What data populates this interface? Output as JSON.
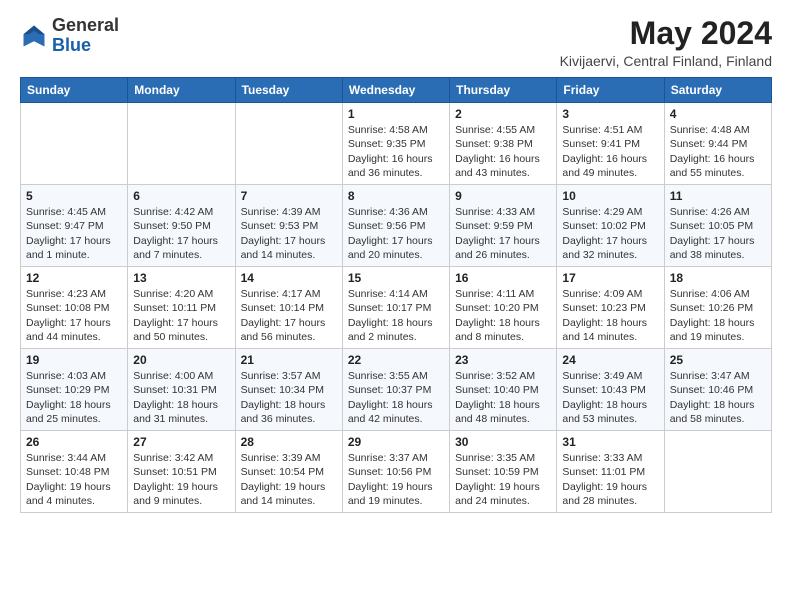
{
  "header": {
    "logo": {
      "general": "General",
      "blue": "Blue"
    },
    "title": "May 2024",
    "location": "Kivijaervi, Central Finland, Finland"
  },
  "days_of_week": [
    "Sunday",
    "Monday",
    "Tuesday",
    "Wednesday",
    "Thursday",
    "Friday",
    "Saturday"
  ],
  "weeks": [
    [
      {
        "day": "",
        "info": ""
      },
      {
        "day": "",
        "info": ""
      },
      {
        "day": "",
        "info": ""
      },
      {
        "day": "1",
        "info": "Sunrise: 4:58 AM\nSunset: 9:35 PM\nDaylight: 16 hours and 36 minutes."
      },
      {
        "day": "2",
        "info": "Sunrise: 4:55 AM\nSunset: 9:38 PM\nDaylight: 16 hours and 43 minutes."
      },
      {
        "day": "3",
        "info": "Sunrise: 4:51 AM\nSunset: 9:41 PM\nDaylight: 16 hours and 49 minutes."
      },
      {
        "day": "4",
        "info": "Sunrise: 4:48 AM\nSunset: 9:44 PM\nDaylight: 16 hours and 55 minutes."
      }
    ],
    [
      {
        "day": "5",
        "info": "Sunrise: 4:45 AM\nSunset: 9:47 PM\nDaylight: 17 hours and 1 minute."
      },
      {
        "day": "6",
        "info": "Sunrise: 4:42 AM\nSunset: 9:50 PM\nDaylight: 17 hours and 7 minutes."
      },
      {
        "day": "7",
        "info": "Sunrise: 4:39 AM\nSunset: 9:53 PM\nDaylight: 17 hours and 14 minutes."
      },
      {
        "day": "8",
        "info": "Sunrise: 4:36 AM\nSunset: 9:56 PM\nDaylight: 17 hours and 20 minutes."
      },
      {
        "day": "9",
        "info": "Sunrise: 4:33 AM\nSunset: 9:59 PM\nDaylight: 17 hours and 26 minutes."
      },
      {
        "day": "10",
        "info": "Sunrise: 4:29 AM\nSunset: 10:02 PM\nDaylight: 17 hours and 32 minutes."
      },
      {
        "day": "11",
        "info": "Sunrise: 4:26 AM\nSunset: 10:05 PM\nDaylight: 17 hours and 38 minutes."
      }
    ],
    [
      {
        "day": "12",
        "info": "Sunrise: 4:23 AM\nSunset: 10:08 PM\nDaylight: 17 hours and 44 minutes."
      },
      {
        "day": "13",
        "info": "Sunrise: 4:20 AM\nSunset: 10:11 PM\nDaylight: 17 hours and 50 minutes."
      },
      {
        "day": "14",
        "info": "Sunrise: 4:17 AM\nSunset: 10:14 PM\nDaylight: 17 hours and 56 minutes."
      },
      {
        "day": "15",
        "info": "Sunrise: 4:14 AM\nSunset: 10:17 PM\nDaylight: 18 hours and 2 minutes."
      },
      {
        "day": "16",
        "info": "Sunrise: 4:11 AM\nSunset: 10:20 PM\nDaylight: 18 hours and 8 minutes."
      },
      {
        "day": "17",
        "info": "Sunrise: 4:09 AM\nSunset: 10:23 PM\nDaylight: 18 hours and 14 minutes."
      },
      {
        "day": "18",
        "info": "Sunrise: 4:06 AM\nSunset: 10:26 PM\nDaylight: 18 hours and 19 minutes."
      }
    ],
    [
      {
        "day": "19",
        "info": "Sunrise: 4:03 AM\nSunset: 10:29 PM\nDaylight: 18 hours and 25 minutes."
      },
      {
        "day": "20",
        "info": "Sunrise: 4:00 AM\nSunset: 10:31 PM\nDaylight: 18 hours and 31 minutes."
      },
      {
        "day": "21",
        "info": "Sunrise: 3:57 AM\nSunset: 10:34 PM\nDaylight: 18 hours and 36 minutes."
      },
      {
        "day": "22",
        "info": "Sunrise: 3:55 AM\nSunset: 10:37 PM\nDaylight: 18 hours and 42 minutes."
      },
      {
        "day": "23",
        "info": "Sunrise: 3:52 AM\nSunset: 10:40 PM\nDaylight: 18 hours and 48 minutes."
      },
      {
        "day": "24",
        "info": "Sunrise: 3:49 AM\nSunset: 10:43 PM\nDaylight: 18 hours and 53 minutes."
      },
      {
        "day": "25",
        "info": "Sunrise: 3:47 AM\nSunset: 10:46 PM\nDaylight: 18 hours and 58 minutes."
      }
    ],
    [
      {
        "day": "26",
        "info": "Sunrise: 3:44 AM\nSunset: 10:48 PM\nDaylight: 19 hours and 4 minutes."
      },
      {
        "day": "27",
        "info": "Sunrise: 3:42 AM\nSunset: 10:51 PM\nDaylight: 19 hours and 9 minutes."
      },
      {
        "day": "28",
        "info": "Sunrise: 3:39 AM\nSunset: 10:54 PM\nDaylight: 19 hours and 14 minutes."
      },
      {
        "day": "29",
        "info": "Sunrise: 3:37 AM\nSunset: 10:56 PM\nDaylight: 19 hours and 19 minutes."
      },
      {
        "day": "30",
        "info": "Sunrise: 3:35 AM\nSunset: 10:59 PM\nDaylight: 19 hours and 24 minutes."
      },
      {
        "day": "31",
        "info": "Sunrise: 3:33 AM\nSunset: 11:01 PM\nDaylight: 19 hours and 28 minutes."
      },
      {
        "day": "",
        "info": ""
      }
    ]
  ]
}
